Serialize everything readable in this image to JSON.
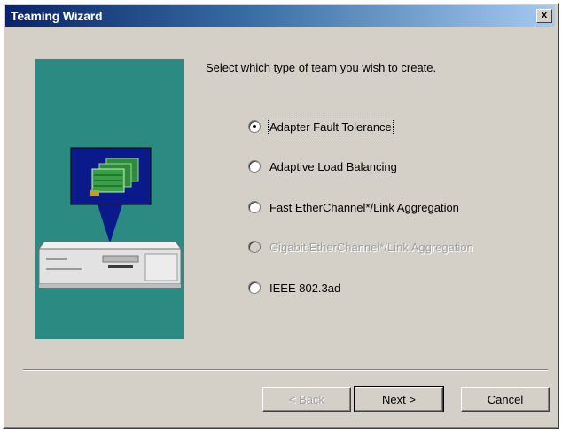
{
  "window": {
    "title": "Teaming Wizard",
    "close_glyph": "x"
  },
  "prompt": "Select which type of team you wish to create.",
  "options": [
    {
      "label": "Adapter Fault Tolerance",
      "selected": true,
      "enabled": true
    },
    {
      "label": "Adaptive Load Balancing",
      "selected": false,
      "enabled": true
    },
    {
      "label": "Fast EtherChannel*/Link Aggregation",
      "selected": false,
      "enabled": true
    },
    {
      "label": "Gigabit EtherChannel*/Link Aggregation",
      "selected": false,
      "enabled": false
    },
    {
      "label": "IEEE 802.3ad",
      "selected": false,
      "enabled": true
    }
  ],
  "buttons": {
    "back": "< Back",
    "next": "Next >",
    "cancel": "Cancel"
  },
  "colors": {
    "title_gradient_start": "#0a246a",
    "title_gradient_end": "#a6caf0",
    "illustration_bg": "#2b8a82",
    "dialog_face": "#d4d0c8"
  },
  "illustration": {
    "icon": "network-adapters-computer-icon"
  }
}
